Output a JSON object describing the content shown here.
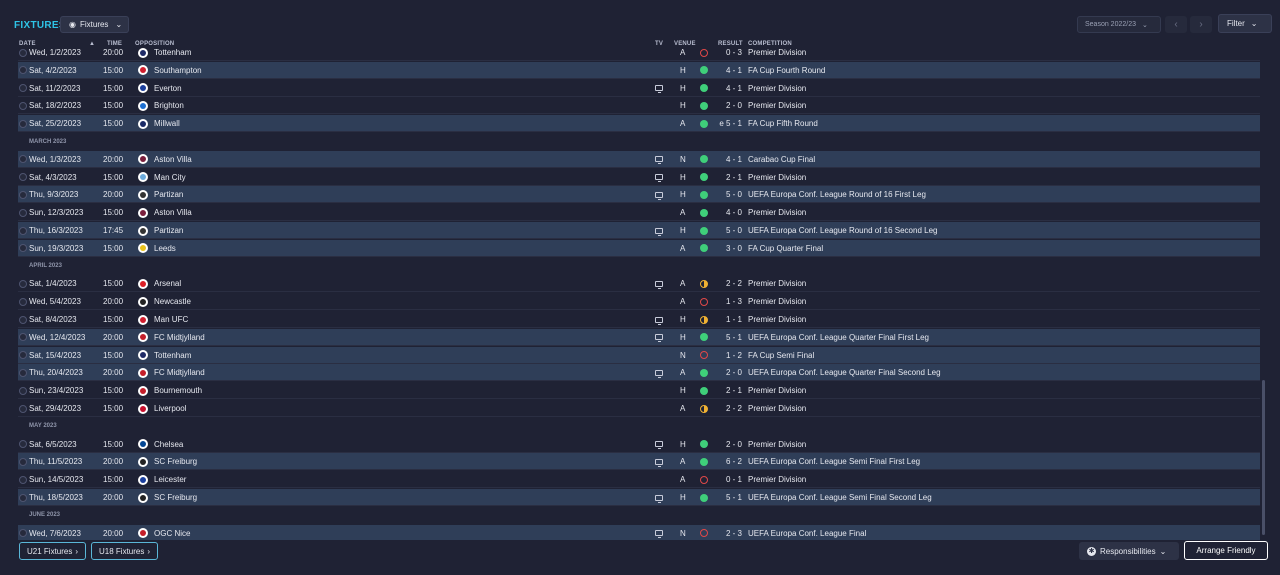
{
  "header": {
    "title": "FIXTURES",
    "view_label": "Fixtures",
    "season_label": "Season 2022/23",
    "filter_label": "Filter"
  },
  "columns": {
    "date": "DATE",
    "sort_indicator": "▲",
    "time": "TIME",
    "opposition": "OPPOSITION",
    "tv": "TV",
    "venue": "VENUE",
    "result": "RESULT",
    "competition": "COMPETITION"
  },
  "rows": [
    {
      "type": "fixture",
      "date": "Wed, 1/2/2023",
      "time": "20:00",
      "opponent": "Tottenham",
      "crest": "#1e2a66",
      "tv": false,
      "venue": "A",
      "outcome": "loss",
      "result": "0 - 3",
      "competition": "Premier Division",
      "highlight": false
    },
    {
      "type": "fixture",
      "date": "Sat, 4/2/2023",
      "time": "15:00",
      "opponent": "Southampton",
      "crest": "#d11f2f",
      "tv": false,
      "venue": "H",
      "outcome": "win",
      "result": "4 - 1",
      "competition": "FA Cup Fourth Round",
      "highlight": true
    },
    {
      "type": "fixture",
      "date": "Sat, 11/2/2023",
      "time": "15:00",
      "opponent": "Everton",
      "crest": "#1b3f9e",
      "tv": true,
      "venue": "H",
      "outcome": "win",
      "result": "4 - 1",
      "competition": "Premier Division",
      "highlight": false
    },
    {
      "type": "fixture",
      "date": "Sat, 18/2/2023",
      "time": "15:00",
      "opponent": "Brighton",
      "crest": "#1d6fd1",
      "tv": false,
      "venue": "H",
      "outcome": "win",
      "result": "2 - 0",
      "competition": "Premier Division",
      "highlight": false
    },
    {
      "type": "fixture",
      "date": "Sat, 25/2/2023",
      "time": "15:00",
      "opponent": "Millwall",
      "crest": "#1a2a66",
      "tv": false,
      "venue": "A",
      "outcome": "win",
      "result": "e 5 - 1",
      "competition": "FA Cup Fifth Round",
      "highlight": true
    },
    {
      "type": "month",
      "label": "MARCH 2023"
    },
    {
      "type": "fixture",
      "date": "Wed, 1/3/2023",
      "time": "20:00",
      "opponent": "Aston Villa",
      "crest": "#7a1f3d",
      "tv": true,
      "venue": "N",
      "outcome": "win",
      "result": "4 - 1",
      "competition": "Carabao Cup Final",
      "highlight": true
    },
    {
      "type": "fixture",
      "date": "Sat, 4/3/2023",
      "time": "15:00",
      "opponent": "Man City",
      "crest": "#6cabdd",
      "tv": true,
      "venue": "H",
      "outcome": "win",
      "result": "2 - 1",
      "competition": "Premier Division",
      "highlight": false
    },
    {
      "type": "fixture",
      "date": "Thu, 9/3/2023",
      "time": "20:00",
      "opponent": "Partizan",
      "crest": "#333333",
      "tv": true,
      "venue": "H",
      "outcome": "win",
      "result": "5 - 0",
      "competition": "UEFA Europa Conf. League Round of 16  First Leg",
      "highlight": true
    },
    {
      "type": "fixture",
      "date": "Sun, 12/3/2023",
      "time": "15:00",
      "opponent": "Aston Villa",
      "crest": "#7a1f3d",
      "tv": false,
      "venue": "A",
      "outcome": "win",
      "result": "4 - 0",
      "competition": "Premier Division",
      "highlight": false
    },
    {
      "type": "fixture",
      "date": "Thu, 16/3/2023",
      "time": "17:45",
      "opponent": "Partizan",
      "crest": "#333333",
      "tv": true,
      "venue": "H",
      "outcome": "win",
      "result": "5 - 0",
      "competition": "UEFA Europa Conf. League Round of 16  Second Leg",
      "highlight": true
    },
    {
      "type": "fixture",
      "date": "Sun, 19/3/2023",
      "time": "15:00",
      "opponent": "Leeds",
      "crest": "#e8c21b",
      "tv": false,
      "venue": "A",
      "outcome": "win",
      "result": "3 - 0",
      "competition": "FA Cup Quarter Final",
      "highlight": true
    },
    {
      "type": "month",
      "label": "APRIL 2023"
    },
    {
      "type": "fixture",
      "date": "Sat, 1/4/2023",
      "time": "15:00",
      "opponent": "Arsenal",
      "crest": "#db1f26",
      "tv": true,
      "venue": "A",
      "outcome": "draw",
      "result": "2 - 2",
      "competition": "Premier Division",
      "highlight": false
    },
    {
      "type": "fixture",
      "date": "Wed, 5/4/2023",
      "time": "20:00",
      "opponent": "Newcastle",
      "crest": "#222222",
      "tv": false,
      "venue": "A",
      "outcome": "loss",
      "result": "1 - 3",
      "competition": "Premier Division",
      "highlight": false
    },
    {
      "type": "fixture",
      "date": "Sat, 8/4/2023",
      "time": "15:00",
      "opponent": "Man UFC",
      "crest": "#d11f2f",
      "tv": true,
      "venue": "H",
      "outcome": "draw",
      "result": "1 - 1",
      "competition": "Premier Division",
      "highlight": false
    },
    {
      "type": "fixture",
      "date": "Wed, 12/4/2023",
      "time": "20:00",
      "opponent": "FC Midtjylland",
      "crest": "#c41e2a",
      "tv": true,
      "venue": "H",
      "outcome": "win",
      "result": "5 - 1",
      "competition": "UEFA Europa Conf. League Quarter Final First Leg",
      "highlight": true
    },
    {
      "type": "fixture",
      "date": "Sat, 15/4/2023",
      "time": "15:00",
      "opponent": "Tottenham",
      "crest": "#1e2a66",
      "tv": false,
      "venue": "N",
      "outcome": "loss",
      "result": "1 - 2",
      "competition": "FA Cup Semi Final",
      "highlight": true
    },
    {
      "type": "fixture",
      "date": "Thu, 20/4/2023",
      "time": "20:00",
      "opponent": "FC Midtjylland",
      "crest": "#c41e2a",
      "tv": true,
      "venue": "A",
      "outcome": "win",
      "result": "2 - 0",
      "competition": "UEFA Europa Conf. League Quarter Final Second Leg",
      "highlight": true
    },
    {
      "type": "fixture",
      "date": "Sun, 23/4/2023",
      "time": "15:00",
      "opponent": "Bournemouth",
      "crest": "#c41e2a",
      "tv": false,
      "venue": "H",
      "outcome": "win",
      "result": "2 - 1",
      "competition": "Premier Division",
      "highlight": false
    },
    {
      "type": "fixture",
      "date": "Sat, 29/4/2023",
      "time": "15:00",
      "opponent": "Liverpool",
      "crest": "#c8102e",
      "tv": false,
      "venue": "A",
      "outcome": "draw",
      "result": "2 - 2",
      "competition": "Premier Division",
      "highlight": false
    },
    {
      "type": "month",
      "label": "MAY 2023"
    },
    {
      "type": "fixture",
      "date": "Sat, 6/5/2023",
      "time": "15:00",
      "opponent": "Chelsea",
      "crest": "#034694",
      "tv": true,
      "venue": "H",
      "outcome": "win",
      "result": "2 - 0",
      "competition": "Premier Division",
      "highlight": false
    },
    {
      "type": "fixture",
      "date": "Thu, 11/5/2023",
      "time": "20:00",
      "opponent": "SC Freiburg",
      "crest": "#222222",
      "tv": true,
      "venue": "A",
      "outcome": "win",
      "result": "6 - 2",
      "competition": "UEFA Europa Conf. League Semi Final First Leg",
      "highlight": true
    },
    {
      "type": "fixture",
      "date": "Sun, 14/5/2023",
      "time": "15:00",
      "opponent": "Leicester",
      "crest": "#1b3f9e",
      "tv": false,
      "venue": "A",
      "outcome": "loss",
      "result": "0 - 1",
      "competition": "Premier Division",
      "highlight": false
    },
    {
      "type": "fixture",
      "date": "Thu, 18/5/2023",
      "time": "20:00",
      "opponent": "SC Freiburg",
      "crest": "#222222",
      "tv": true,
      "venue": "H",
      "outcome": "win",
      "result": "5 - 1",
      "competition": "UEFA Europa Conf. League Semi Final Second Leg",
      "highlight": true
    },
    {
      "type": "month",
      "label": "JUNE 2023"
    },
    {
      "type": "fixture",
      "date": "Wed, 7/6/2023",
      "time": "20:00",
      "opponent": "OGC Nice",
      "crest": "#c41e2a",
      "tv": true,
      "venue": "N",
      "outcome": "loss",
      "result": "2 - 3",
      "competition": "UEFA Europa Conf. League Final",
      "highlight": true
    }
  ],
  "footer": {
    "u21_label": "U21 Fixtures",
    "u18_label": "U18 Fixtures",
    "responsibilities_label": "Responsibilities",
    "arrange_label": "Arrange Friendly"
  },
  "colors": {
    "accent": "#2ec4e6",
    "win": "#3fcf7a",
    "loss": "#e04848",
    "draw": "#f0b233",
    "row_highlight": "#2f3e58"
  },
  "icons": {
    "view": "eye-icon",
    "dropdown": "chevron-down-icon",
    "prev": "chevron-left-icon",
    "next": "chevron-right-icon",
    "tv": "tv-icon",
    "responsibilities": "gear-icon"
  }
}
